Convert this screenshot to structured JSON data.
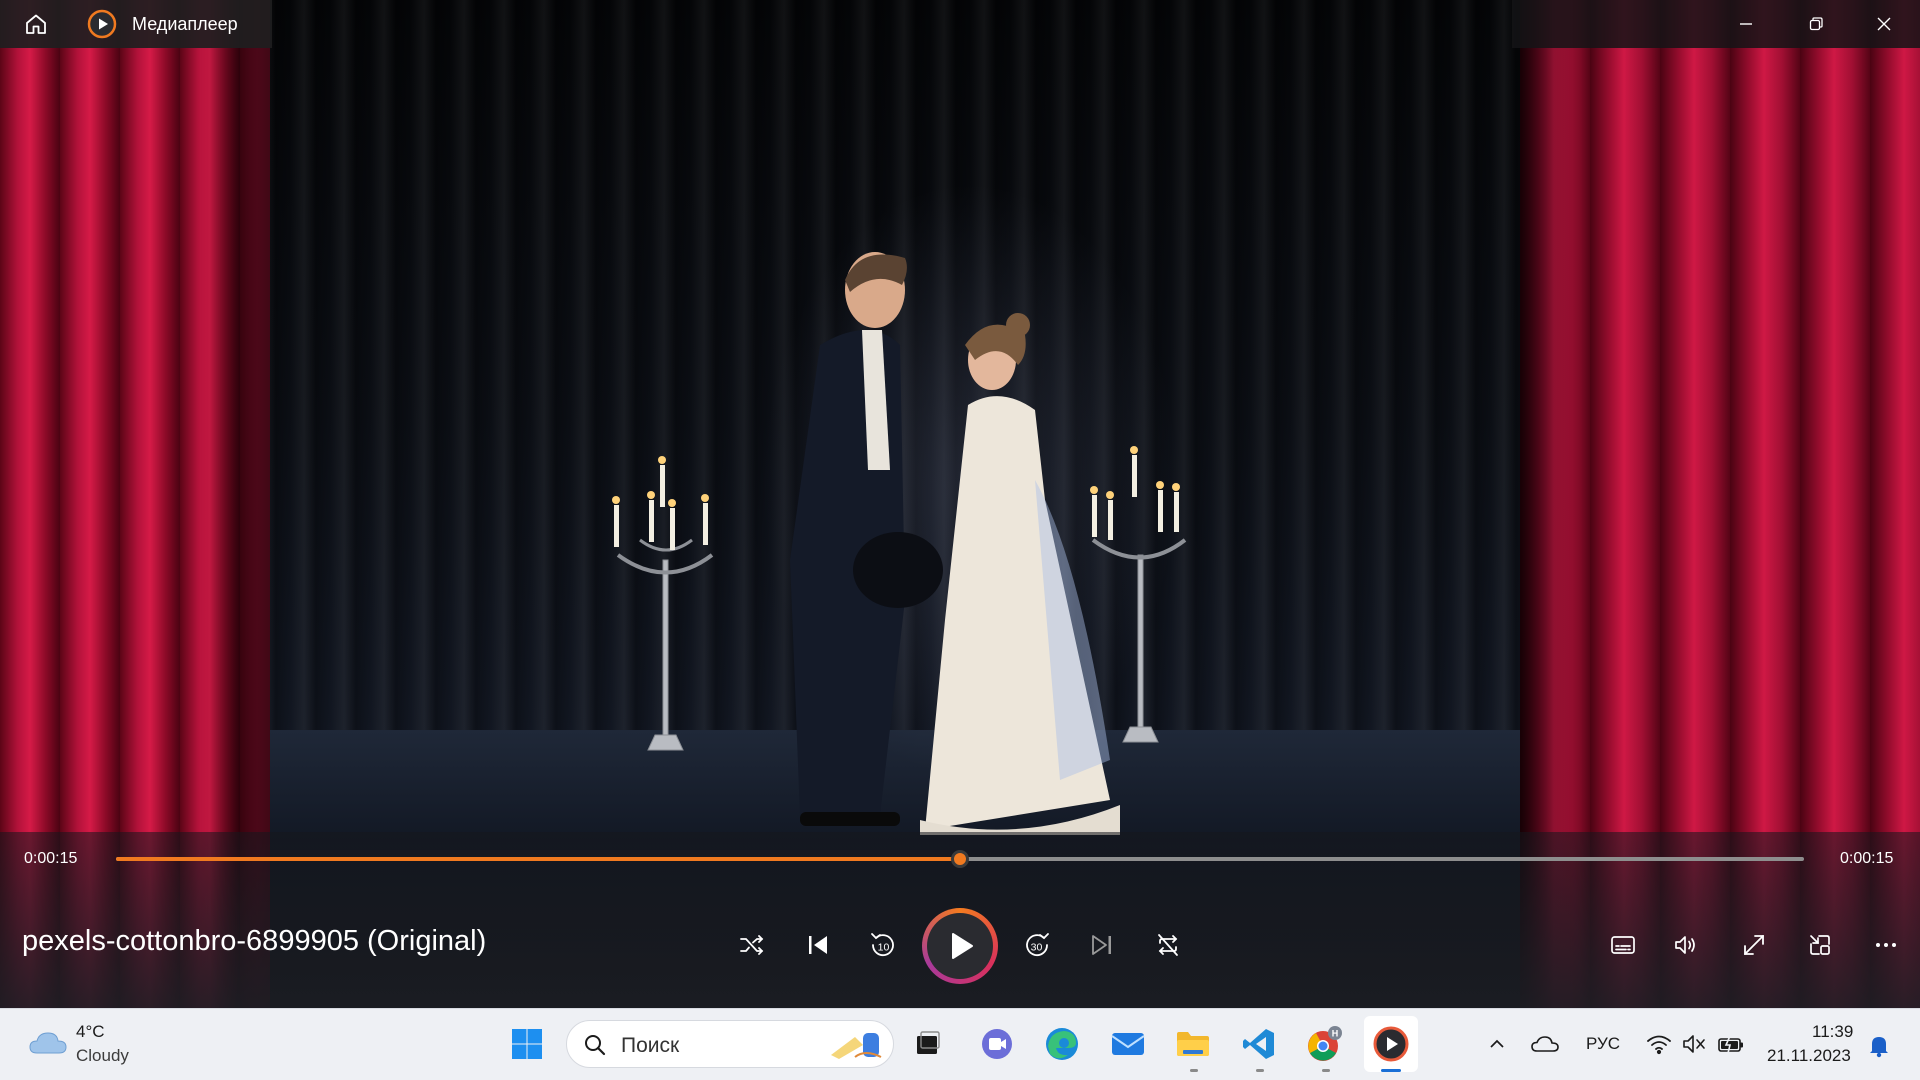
{
  "window": {
    "app_title": "Медиаплеер",
    "home_icon": "home-icon",
    "app_icon": "media-player-icon",
    "minimize_icon": "minimize-icon",
    "restore_icon": "restore-icon",
    "close_icon": "close-icon"
  },
  "player": {
    "current_time": "0:00:15",
    "total_time": "0:00:15",
    "progress": 0.5,
    "file_title": "pexels-cottonbro-6899905 (Original)",
    "accent_color": "#f07a20",
    "controls": {
      "left": [
        {
          "name": "shuffle-button",
          "icon": "shuffle-icon"
        },
        {
          "name": "previous-button",
          "icon": "previous-icon"
        },
        {
          "name": "rewind-10-button",
          "icon": "rewind-10-icon",
          "label": "10"
        }
      ],
      "play": {
        "name": "play-button",
        "icon": "play-icon"
      },
      "right": [
        {
          "name": "forward-30-button",
          "icon": "forward-30-icon",
          "label": "30"
        },
        {
          "name": "next-button",
          "icon": "next-icon"
        },
        {
          "name": "repeat-button",
          "icon": "repeat-off-icon"
        }
      ],
      "extra": [
        {
          "name": "subtitles-button",
          "icon": "subtitles-icon"
        },
        {
          "name": "volume-button",
          "icon": "volume-icon"
        },
        {
          "name": "fullscreen-button",
          "icon": "fullscreen-icon"
        },
        {
          "name": "mini-player-button",
          "icon": "mini-player-icon"
        },
        {
          "name": "more-options-button",
          "icon": "more-icon"
        }
      ]
    }
  },
  "taskbar": {
    "weather": {
      "temperature": "4°C",
      "condition": "Cloudy",
      "icon": "cloud-icon"
    },
    "search": {
      "placeholder": "Поиск",
      "icon": "search-icon"
    },
    "apps": [
      {
        "name": "start-button",
        "icon": "windows-start-icon"
      },
      {
        "name": "task-view-button",
        "icon": "task-view-icon"
      },
      {
        "name": "teams-app",
        "icon": "teams-icon"
      },
      {
        "name": "edge-app",
        "icon": "edge-icon"
      },
      {
        "name": "mail-app",
        "icon": "mail-icon"
      },
      {
        "name": "explorer-app",
        "icon": "folder-icon"
      },
      {
        "name": "vscode-app",
        "icon": "vscode-icon"
      },
      {
        "name": "chrome-app",
        "icon": "chrome-icon",
        "badge": "H"
      },
      {
        "name": "media-player-app",
        "icon": "media-player-icon"
      }
    ],
    "tray": {
      "language": "РУС",
      "time": "11:39",
      "date": "21.11.2023"
    }
  }
}
